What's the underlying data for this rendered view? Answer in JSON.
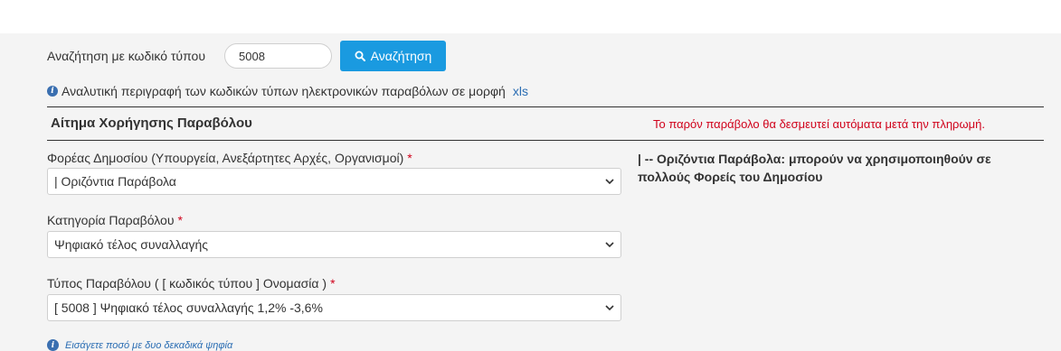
{
  "search": {
    "label": "Αναζήτηση με κωδικό τύπου",
    "value": "5008",
    "button_label": "Αναζήτηση"
  },
  "info": {
    "text": "Αναλυτική περιγραφή των κωδικών τύπων ηλεκτρονικών παραβόλων σε μορφή",
    "link_text": "xls"
  },
  "section": {
    "title": "Αίτημα Χορήγησης Παραβόλου",
    "auto_note": "Το παρόν παράβολο θα δεσμευτεί αυτόματα μετά την πληρωμή."
  },
  "fields": {
    "agency": {
      "label": "Φορέας Δημοσίου (Υπουργεία, Ανεξάρτητες Αρχές, Οργανισμοί)",
      "required_mark": "*",
      "value": "| Οριζόντια Παράβολα"
    },
    "category": {
      "label": "Κατηγορία Παραβόλου",
      "required_mark": "*",
      "value": "Ψηφιακό τέλος συναλλαγής"
    },
    "type": {
      "label": "Τύπος Παραβόλου ( [ κωδικός τύπου ] Ονομασία )",
      "required_mark": "*",
      "value": "[ 5008 ] Ψηφιακό τέλος συναλλαγής 1,2% -3,6%"
    }
  },
  "agency_note": "| -- Οριζόντια Παράβολα: μπορούν να χρησιμοποιηθούν σε πολλούς Φορείς του Δημοσίου",
  "hint": "Εισάγετε ποσό με δυο δεκαδικά ψηφία",
  "colors": {
    "accent": "#1a9ae0",
    "required": "#d0021b",
    "link": "#2a6db3"
  }
}
